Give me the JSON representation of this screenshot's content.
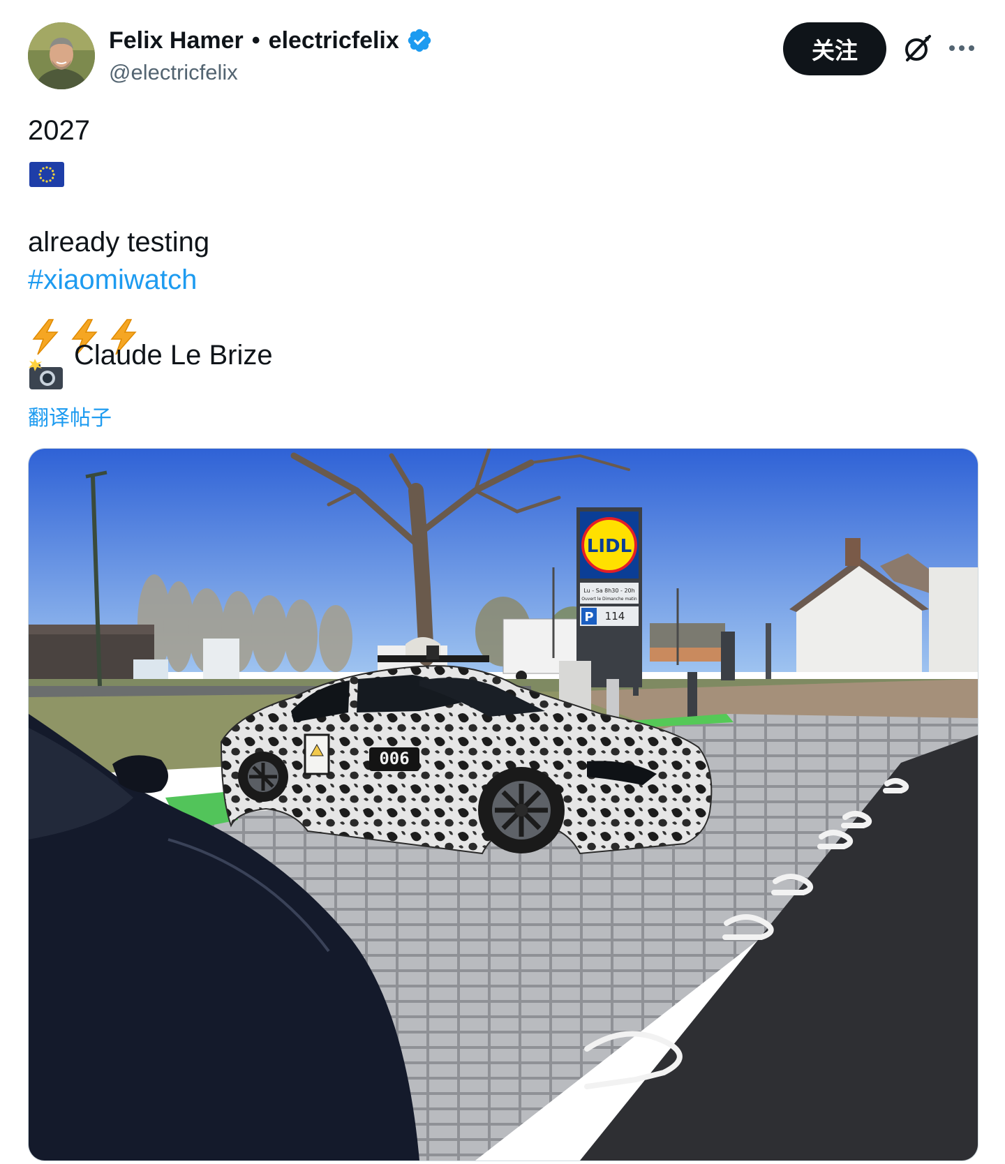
{
  "author": {
    "display_name": "Felix Hamer",
    "separator": "•",
    "brand_name": "electricfelix",
    "handle": "@electricfelix",
    "verified": true,
    "verified_color": "#1d9bf0"
  },
  "actions": {
    "follow_label": "关注",
    "grok_icon": "grok-icon",
    "more_icon": "more-icon"
  },
  "tweet": {
    "line_year": "2027",
    "flag": "eu-flag",
    "line_testing": "already testing",
    "hashtag": "#xiaomiwatch",
    "bolts": [
      "high-voltage",
      "high-voltage",
      "high-voltage"
    ],
    "camera": "camera-with-flash",
    "photo_credit": "Claude Le Brize",
    "translate_label": "翻译帖子",
    "link_color": "#1d9bf0"
  },
  "media": {
    "sign_brand": "LIDL",
    "sign_hours": "Lu - Sa 8h30 - 20h",
    "sign_sunday": "Ouvert le Dimanche matin",
    "parking_letter": "P",
    "parking_count": "114",
    "car_number": "006"
  }
}
